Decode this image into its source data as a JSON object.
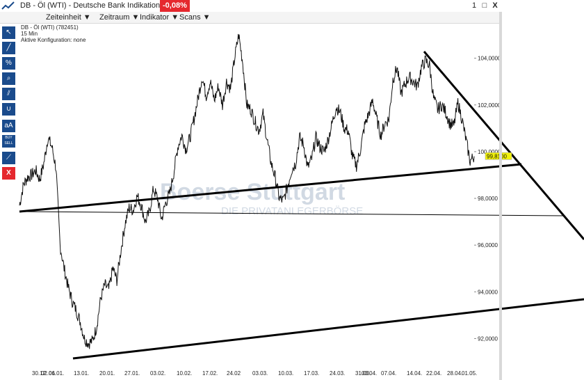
{
  "window": {
    "title": "DB - Öl (WTI) - Deutsche Bank Indikation",
    "change_badge": "-0,08%",
    "badge_color": "#e5282e",
    "controls": [
      "1",
      "□",
      "X"
    ]
  },
  "menu": {
    "items": [
      "Zeiteinheit ▼",
      "Zeitraum ▼",
      "Indikator ▼",
      "Scans ▼"
    ]
  },
  "toolbar": {
    "tools": [
      {
        "icon": "cursor-icon",
        "label": "↖"
      },
      {
        "icon": "line-icon",
        "label": "╱"
      },
      {
        "icon": "percent-icon",
        "label": "%"
      },
      {
        "icon": "zoom-icon",
        "label": "⌕"
      },
      {
        "icon": "parallel-lines-icon",
        "label": "⫽"
      },
      {
        "icon": "curve-icon",
        "label": "∪"
      },
      {
        "icon": "text-icon",
        "label": "aA"
      },
      {
        "icon": "buy-sell-icon",
        "label": "BUY SELL"
      },
      {
        "icon": "fibonacci-icon",
        "label": "⟋"
      },
      {
        "icon": "delete-icon",
        "label": "X"
      }
    ]
  },
  "chart_info": {
    "line1": "DB - Öl (WTI) (782451)",
    "line2": "15 Min",
    "line3": "Aktive Konfiguration: none"
  },
  "watermark": {
    "line1": "Boerse Stuttgart",
    "line2": "DIE PRIVATANLEGERBÖRSE"
  },
  "chart_data": {
    "type": "line",
    "title": "",
    "xlabel": "",
    "ylabel": "",
    "ylim": [
      91.0,
      105.3
    ],
    "y_ticks": [
      "104,0000",
      "102,0000",
      "100,0000",
      "98,0000",
      "96,0000",
      "94,0000",
      "92,0000"
    ],
    "y_tick_values": [
      104,
      102,
      100,
      98,
      96,
      94,
      92
    ],
    "x_ticks": [
      "30.12.",
      "02.01.",
      "06.01.",
      "13.01.",
      "20.01.",
      "27.01.",
      "03.02.",
      "10.02.",
      "17.02.",
      "24.02",
      "03.03.",
      "10.03.",
      "17.03.",
      "24.03.",
      "31.03.",
      "03.04.",
      "07.04.",
      "14.04.",
      "22.04.",
      "28.04.",
      "01.05."
    ],
    "last_price_label": "99,8100",
    "last_price": 99.81,
    "series": [
      {
        "values": [
          97.7,
          98.6,
          98.9,
          99.0,
          99.2,
          98.8,
          99.5,
          100.6,
          100.2,
          99.3,
          96.0,
          95.0,
          94.2,
          93.6,
          93.2,
          92.7,
          92.0,
          91.8,
          91.9,
          92.5,
          93.7,
          94.3,
          94.1,
          95.0,
          94.5,
          95.8,
          96.9,
          97.6,
          97.5,
          98.1,
          97.7,
          97.0,
          97.4,
          98.4,
          98.0,
          97.1,
          97.8,
          98.2,
          99.1,
          100.2,
          100.7,
          100.1,
          100.6,
          101.4,
          102.3,
          103.2,
          102.4,
          103.0,
          102.2,
          102.8,
          102.0,
          103.0,
          102.7,
          104.0,
          105.0,
          103.8,
          102.0,
          101.8,
          101.3,
          100.9,
          101.6,
          100.5,
          99.5,
          98.9,
          98.0,
          97.9,
          98.5,
          99.2,
          99.5,
          100.6,
          100.3,
          99.3,
          99.7,
          100.6,
          100.2,
          100.0,
          100.5,
          101.2,
          101.9,
          101.7,
          101.0,
          100.9,
          99.8,
          99.4,
          100.1,
          101.1,
          101.6,
          102.2,
          101.4,
          100.7,
          101.2,
          101.4,
          103.1,
          103.6,
          102.5,
          102.9,
          103.2,
          103.0,
          102.8,
          103.6,
          103.9,
          103.7,
          102.3,
          101.8,
          102.0,
          101.7,
          101.2,
          101.1,
          102.1,
          101.4,
          100.5,
          99.6,
          99.8
        ]
      }
    ],
    "grid": false,
    "legend": "none",
    "colors": {
      "price_line": "#111111",
      "trend_lines": "#000000",
      "axis_text": "#222222",
      "last_price_bg": "#f2f20a"
    }
  }
}
